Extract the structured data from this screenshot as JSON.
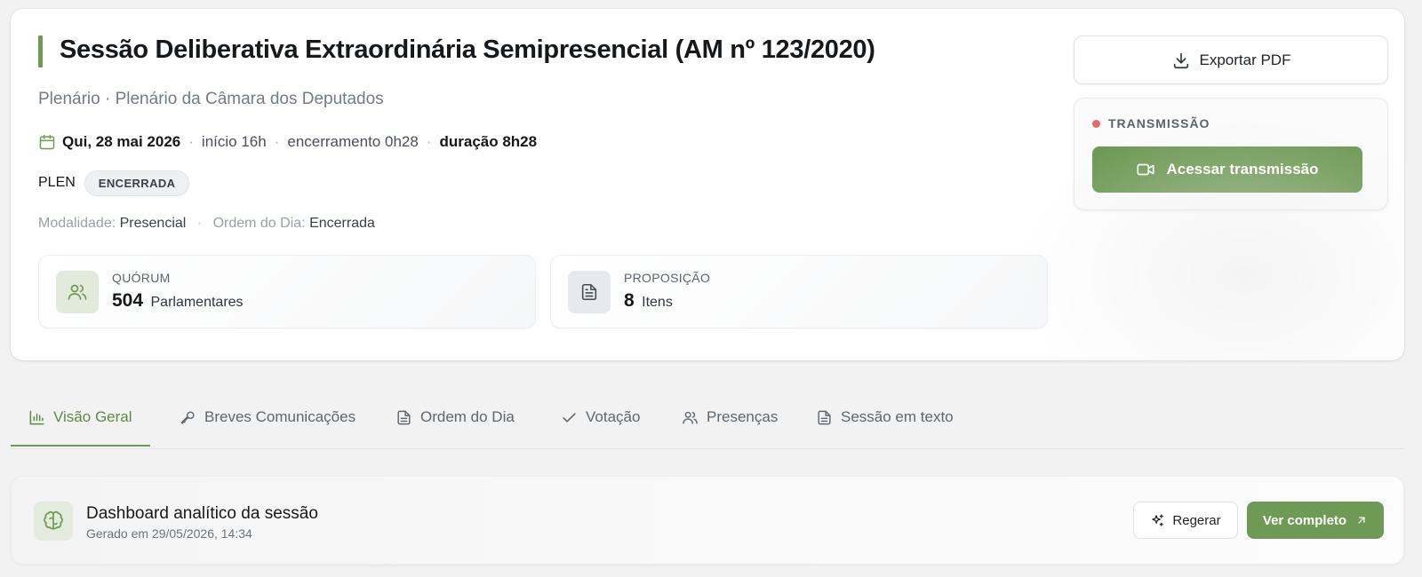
{
  "session": {
    "title": "Sessão Deliberativa Extraordinária Semipresencial (AM nº 123/2020)",
    "subtitle": "Plenário · Plenário da Câmara dos Deputados",
    "date": "Qui, 28 mai 2026",
    "start": "início 16h",
    "end": "encerramento 0h28",
    "duration": "duração 8h28",
    "org": "PLEN",
    "status_badge": "ENCERRADA",
    "modality_label": "Modalidade:",
    "modality_value": "Presencial",
    "agenda_label": "Ordem do Dia:",
    "agenda_value": "Encerrada"
  },
  "stats": {
    "quorum": {
      "label": "QUÓRUM",
      "value": "504",
      "unit": "Parlamentares"
    },
    "proposicao": {
      "label": "PROPOSIÇÃO",
      "value": "8",
      "unit": "Itens"
    }
  },
  "actions": {
    "export_label": "Exportar PDF",
    "transmission_heading": "TRANSMISSÃO",
    "transmission_button": "Acessar transmissão"
  },
  "tabs": [
    {
      "label": "Visão Geral",
      "icon": "bar-chart-icon",
      "active": true
    },
    {
      "label": "Breves Comunicações",
      "icon": "mic-icon",
      "active": false
    },
    {
      "label": "Ordem do Dia",
      "icon": "document-icon",
      "active": false
    },
    {
      "label": "Votação",
      "icon": "check-icon",
      "active": false
    },
    {
      "label": "Presenças",
      "icon": "users-icon",
      "active": false
    },
    {
      "label": "Sessão em texto",
      "icon": "document-icon",
      "active": false
    }
  ],
  "dashboard": {
    "title": "Dashboard analítico da sessão",
    "generated": "Gerado em 29/05/2026, 14:34",
    "regenerate_label": "Regerar",
    "view_label": "Ver completo"
  },
  "colors": {
    "accent": "#6f9a55",
    "live": "#e86a6a",
    "background": "#f2f2f2"
  }
}
